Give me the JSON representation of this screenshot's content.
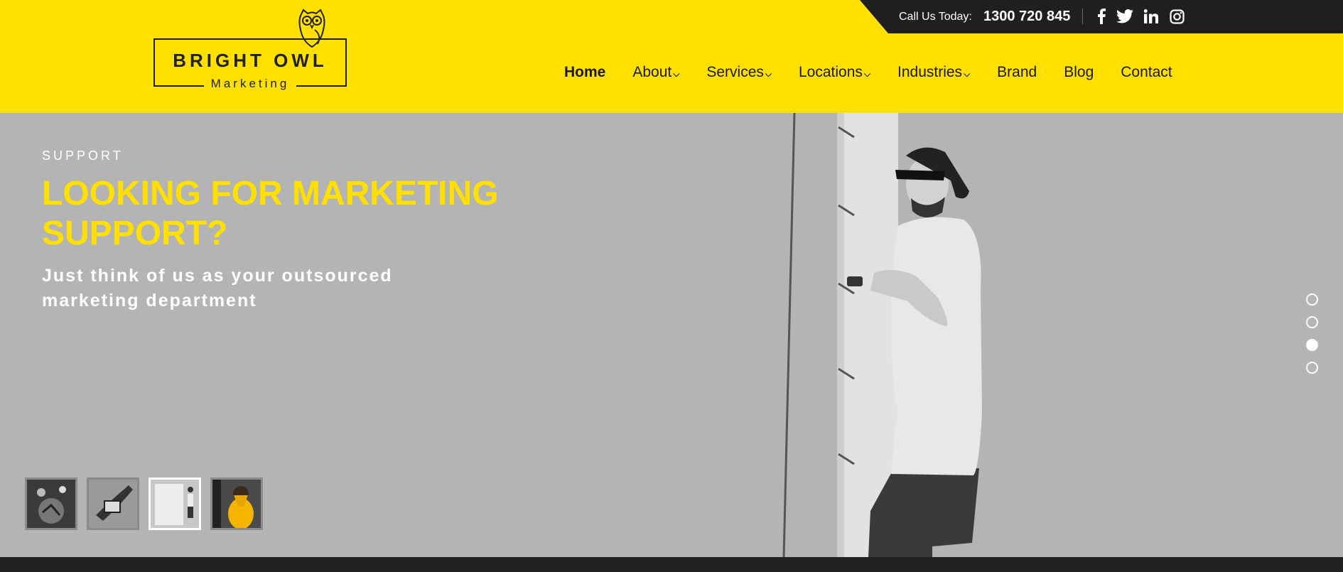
{
  "header": {
    "call_label": "Call Us Today:",
    "phone": "1300 720 845",
    "social": [
      "facebook-icon",
      "twitter-icon",
      "linkedin-icon",
      "instagram-icon"
    ]
  },
  "logo": {
    "main": "BRIGHT OWL",
    "sub": "Marketing"
  },
  "nav": {
    "items": [
      {
        "label": "Home",
        "dropdown": false,
        "active": true
      },
      {
        "label": "About",
        "dropdown": true
      },
      {
        "label": "Services",
        "dropdown": true
      },
      {
        "label": "Locations",
        "dropdown": true
      },
      {
        "label": "Industries",
        "dropdown": true
      },
      {
        "label": "Brand",
        "dropdown": false
      },
      {
        "label": "Blog",
        "dropdown": false
      },
      {
        "label": "Contact",
        "dropdown": false
      }
    ]
  },
  "hero": {
    "eyebrow": "SUPPORT",
    "headline": "LOOKING FOR MARKETING SUPPORT?",
    "subhead": "Just think of us as your outsourced marketing department",
    "slide_count": 4,
    "active_slide": 3
  },
  "colors": {
    "brand_yellow": "#ffe000",
    "dark": "#1f1f1f",
    "hero_bg": "#b4b4b4"
  }
}
